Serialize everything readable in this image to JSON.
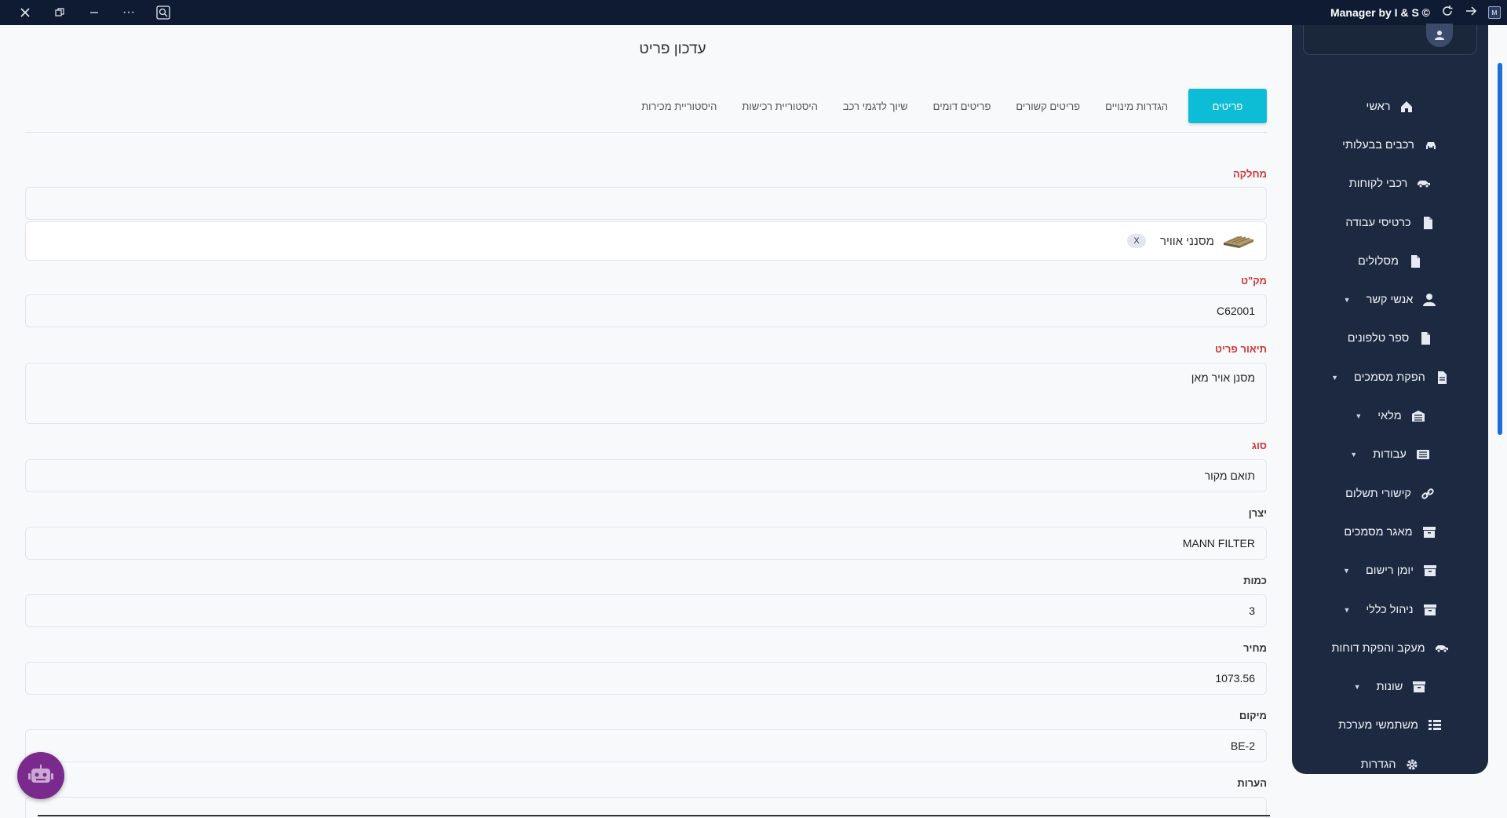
{
  "titlebar": {
    "app_title": "Manager by I & S ©",
    "app_icon_text": "M"
  },
  "page": {
    "title": "עדכון פריט"
  },
  "tabs": [
    {
      "label": "פריטים",
      "active": true
    },
    {
      "label": "הגדרות מינויים"
    },
    {
      "label": "פריטים קשורים"
    },
    {
      "label": "פריטים דומים"
    },
    {
      "label": "שיוך לדגמי רכב"
    },
    {
      "label": "היסטוריית רכישות"
    },
    {
      "label": "היסטוריית מכירות"
    }
  ],
  "form": {
    "department": {
      "label": "מחלקה",
      "value": "",
      "selected_chip": "מסנני אוויר",
      "chip_remove": "X"
    },
    "sku": {
      "label": "מק\"ט",
      "value": "C62001"
    },
    "description": {
      "label": "תיאור פריט",
      "value": "מסנן אויר מאן"
    },
    "type": {
      "label": "סוג",
      "value": "תואם מקור"
    },
    "manufacturer": {
      "label": "יצרן",
      "value": "MANN FILTER"
    },
    "quantity": {
      "label": "כמות",
      "value": "3"
    },
    "price": {
      "label": "מחיר",
      "value": "1073.56"
    },
    "location": {
      "label": "מיקום",
      "value": "BE-2"
    },
    "notes": {
      "label": "הערות",
      "value": ""
    }
  },
  "sidebar": {
    "items": [
      {
        "label": "ראשי",
        "icon": "home-icon"
      },
      {
        "label": "רכבים בבעלותי",
        "icon": "car-icon"
      },
      {
        "label": "רכבי לקוחות",
        "icon": "car-side-icon"
      },
      {
        "label": "כרטיסי עבודה",
        "icon": "file-icon"
      },
      {
        "label": "מסלולים",
        "icon": "file-icon"
      },
      {
        "label": "אנשי קשר",
        "icon": "user-icon",
        "dropdown": true
      },
      {
        "label": "ספר טלפונים",
        "icon": "file-icon"
      },
      {
        "label": "הפקת מסמכים",
        "icon": "file-alt-icon",
        "dropdown": true
      },
      {
        "label": "מלאי",
        "icon": "warehouse-icon",
        "dropdown": true
      },
      {
        "label": "עבודות",
        "icon": "list-icon",
        "dropdown": true
      },
      {
        "label": "קישורי תשלום",
        "icon": "link-icon"
      },
      {
        "label": "מאגר מסמכים",
        "icon": "archive-icon"
      },
      {
        "label": "יומן רישום",
        "icon": "archive-icon",
        "dropdown": true
      },
      {
        "label": "ניהול כללי",
        "icon": "archive-icon",
        "dropdown": true
      },
      {
        "label": "מעקב והפקת דוחות",
        "icon": "car-side-icon"
      },
      {
        "label": "שונות",
        "icon": "archive-icon",
        "dropdown": true
      },
      {
        "label": "משתמשי מערכת",
        "icon": "list-alt-icon"
      },
      {
        "label": "הגדרות",
        "icon": "gear-icon"
      }
    ]
  },
  "colors": {
    "titlebar": "#0e1b33",
    "sidebar": "#1c2940",
    "accent": "#0dbdd6",
    "required_label": "#d23636",
    "bot": "#7a2a8c"
  }
}
